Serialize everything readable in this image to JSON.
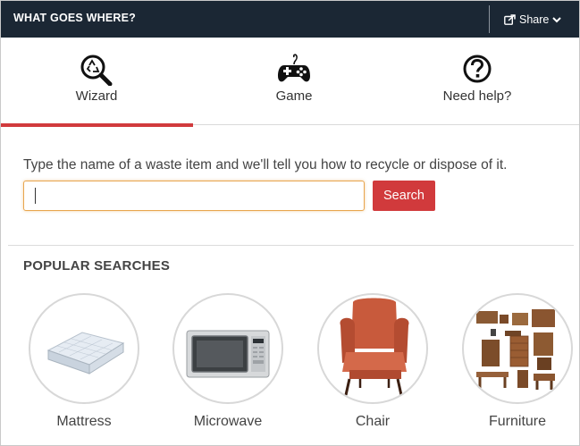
{
  "header": {
    "title": "WHAT GOES WHERE?",
    "share_label": "Share"
  },
  "tabs": [
    {
      "label": "Wizard",
      "icon": "recycle-search-icon",
      "active": true
    },
    {
      "label": "Game",
      "icon": "gamepad-icon",
      "active": false
    },
    {
      "label": "Need help?",
      "icon": "question-circle-icon",
      "active": false
    }
  ],
  "search": {
    "prompt": "Type the name of a waste item and we'll tell you how to recycle or dispose of it.",
    "value": "",
    "placeholder": "",
    "button_label": "Search"
  },
  "popular": {
    "title": "POPULAR SEARCHES",
    "items": [
      {
        "label": "Mattress",
        "icon": "mattress-image"
      },
      {
        "label": "Microwave",
        "icon": "microwave-image"
      },
      {
        "label": "Chair",
        "icon": "armchair-image"
      },
      {
        "label": "Furniture",
        "icon": "furniture-image"
      }
    ]
  },
  "colors": {
    "header_bg": "#1b2734",
    "accent": "#d13a3c",
    "input_focus": "#e8a64f"
  }
}
